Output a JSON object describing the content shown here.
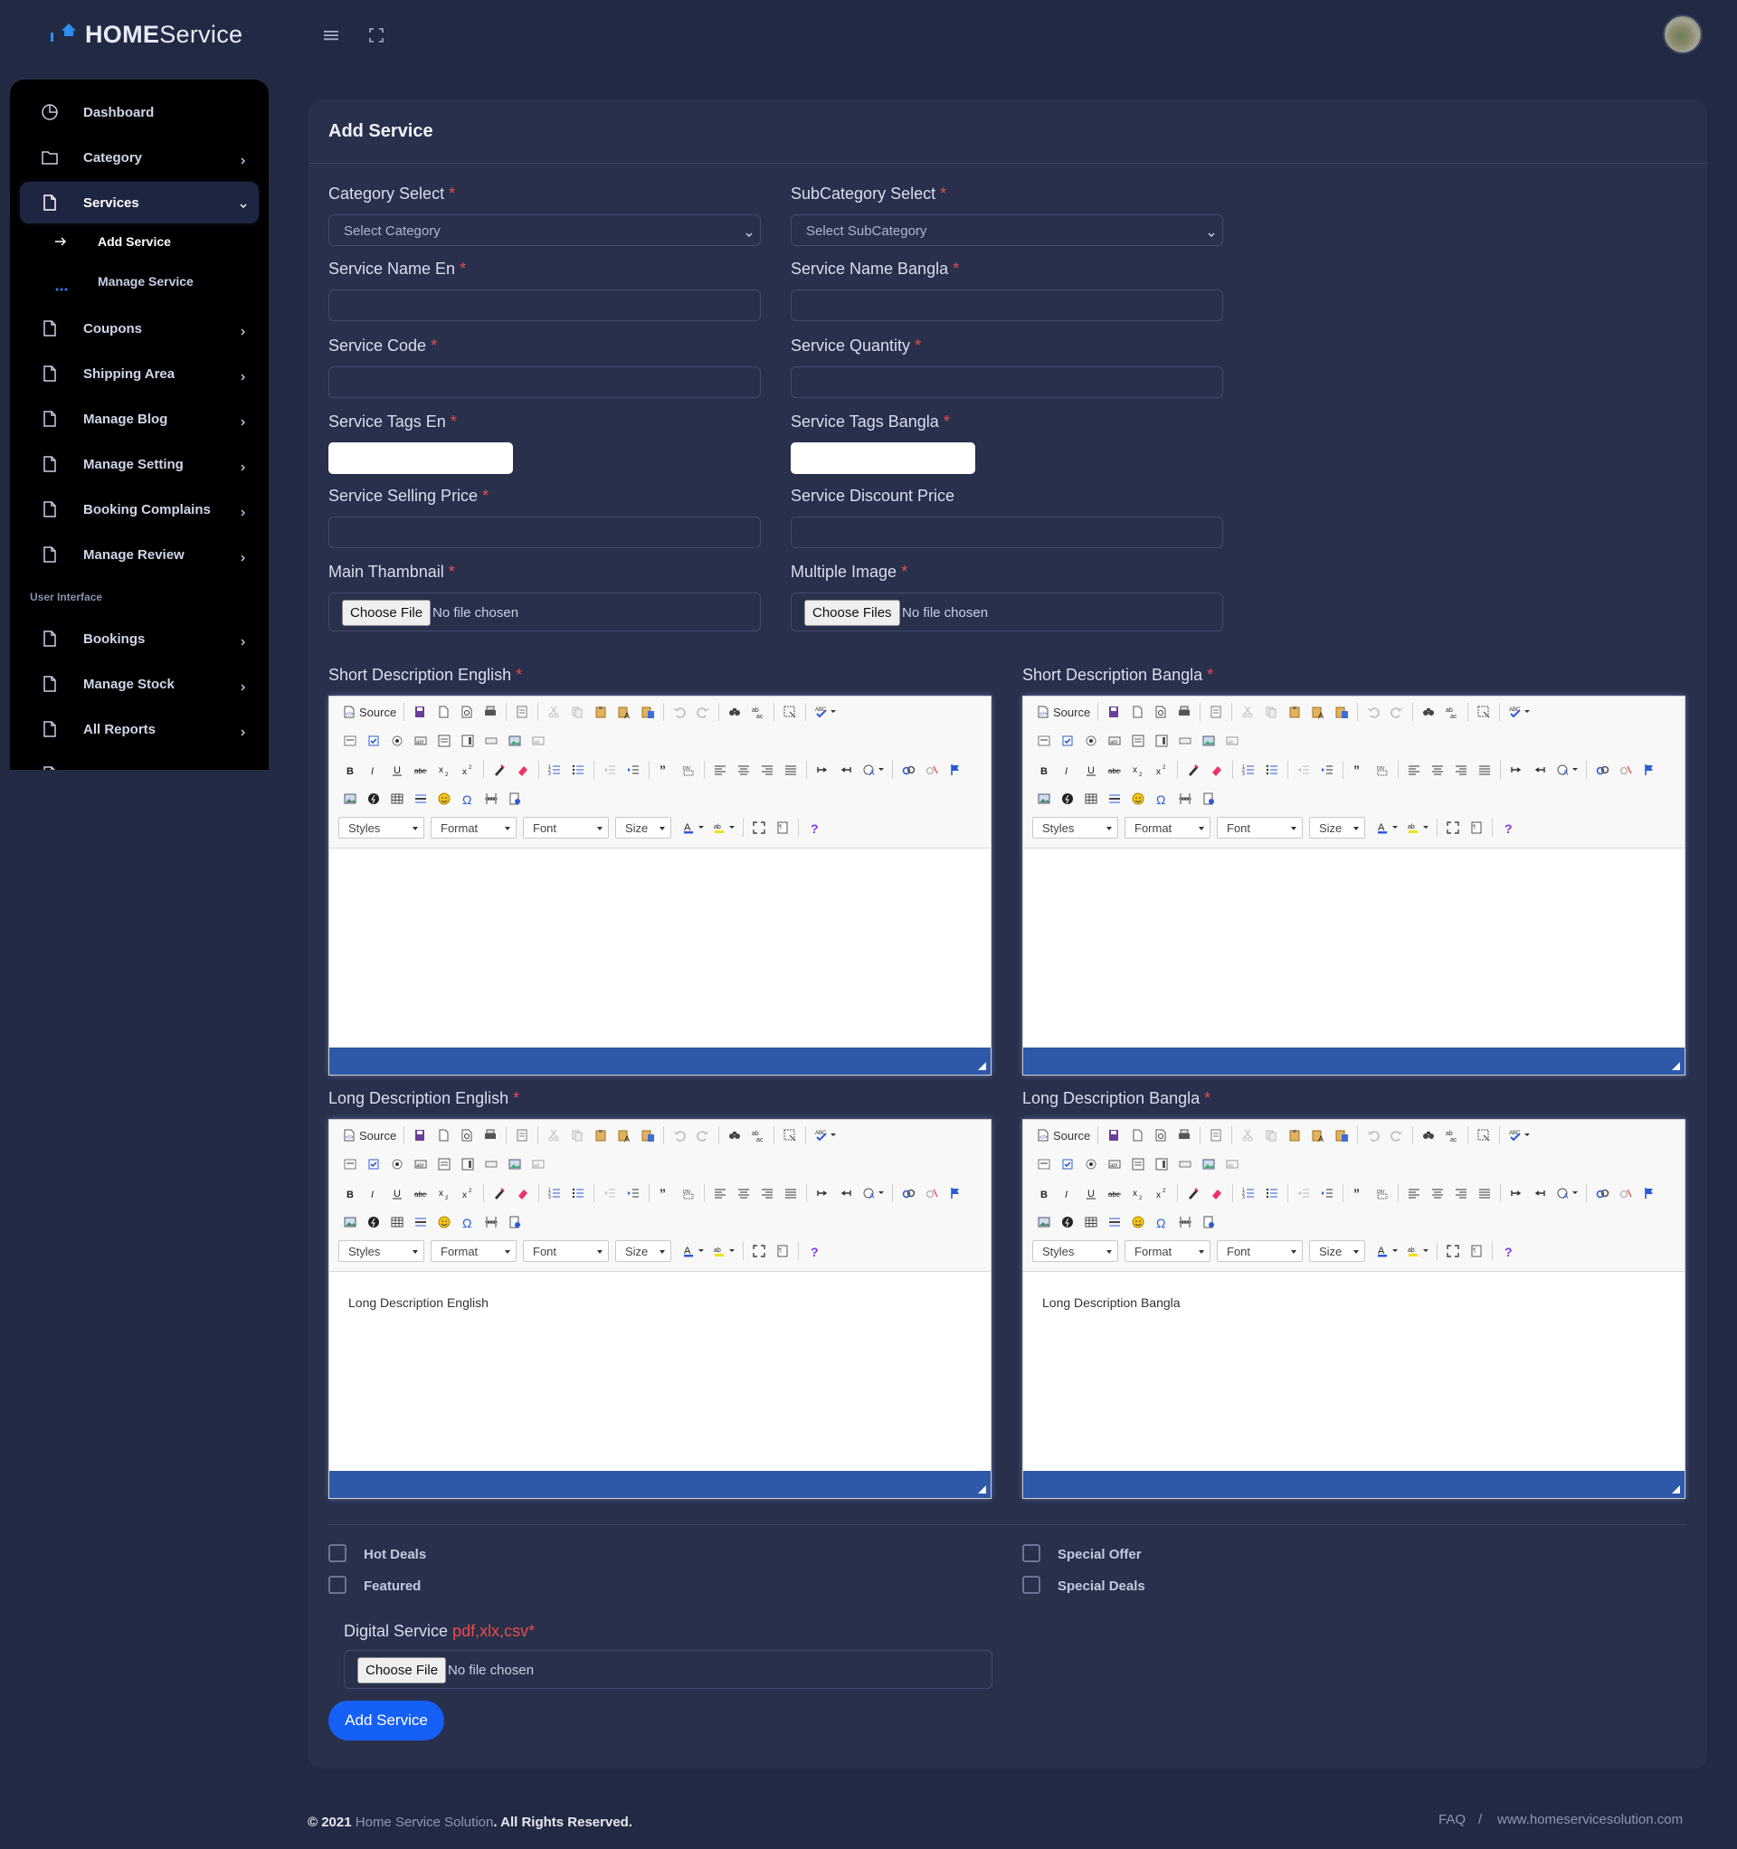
{
  "app": {
    "logo_bold": "HOME",
    "logo_light": "Service"
  },
  "sidebar": {
    "items": [
      {
        "label": "Dashboard",
        "icon": "clock-pie-icon"
      },
      {
        "label": "Category",
        "icon": "folder-icon"
      },
      {
        "label": "Services",
        "icon": "file-icon",
        "active": true
      },
      {
        "label": "Coupons",
        "icon": "file-icon"
      },
      {
        "label": "Shipping Area",
        "icon": "file-icon"
      },
      {
        "label": "Manage Blog",
        "icon": "file-icon"
      },
      {
        "label": "Manage Setting",
        "icon": "file-icon"
      },
      {
        "label": "Booking Complains",
        "icon": "file-icon"
      },
      {
        "label": "Manage Review",
        "icon": "file-icon"
      }
    ],
    "subitems": [
      {
        "label": "Add Service",
        "active": true
      },
      {
        "label": "Manage Service"
      }
    ],
    "section_label": "User Interface",
    "items2": [
      {
        "label": "Bookings"
      },
      {
        "label": "Manage Stock"
      },
      {
        "label": "All Reports"
      }
    ]
  },
  "form": {
    "title": "Add Service",
    "required_mark": "*",
    "category_label": "Category Select",
    "category_placeholder": "Select Category",
    "subcategory_label": "SubCategory Select",
    "subcategory_placeholder": "Select SubCategory",
    "name_en_label": "Service Name En",
    "name_bn_label": "Service Name Bangla",
    "code_label": "Service Code",
    "quantity_label": "Service Quantity",
    "tags_en_label": "Service Tags En",
    "tags_bn_label": "Service Tags Bangla",
    "selling_price_label": "Service Selling Price",
    "discount_price_label": "Service Discount Price",
    "thumbnail_label": "Main Thambnail",
    "multi_image_label": "Multiple Image",
    "choose_file": "Choose File",
    "choose_files": "Choose Files",
    "no_file": "No file chosen",
    "short_desc_en_label": "Short Description English",
    "short_desc_bn_label": "Short Description Bangla",
    "long_desc_en_label": "Long Description English",
    "long_desc_bn_label": "Long Description Bangla",
    "long_desc_en_value": "Long Description English",
    "long_desc_bn_value": "Long Description Bangla",
    "hot_deals": "Hot Deals",
    "featured": "Featured",
    "special_offer": "Special Offer",
    "special_deals": "Special Deals",
    "digital_label": "Digital Service",
    "digital_formats": "pdf,xlx,csv*",
    "submit_label": "Add Service"
  },
  "editor": {
    "source_label": "Source",
    "styles": "Styles",
    "format": "Format",
    "font": "Font",
    "size": "Size"
  },
  "footer": {
    "copyright_prefix": "© 2021",
    "brand": "Home Service Solution",
    "suffix": ". All Rights Reserved.",
    "faq": "FAQ",
    "separator": "/",
    "site": "www.homeservicesolution.com"
  },
  "colors": {
    "background": "#222a43",
    "card": "#28304b",
    "sidebar": "#000000",
    "primary": "#1560f7",
    "required": "#e84c4c",
    "editor_footer": "#2f59a8"
  }
}
